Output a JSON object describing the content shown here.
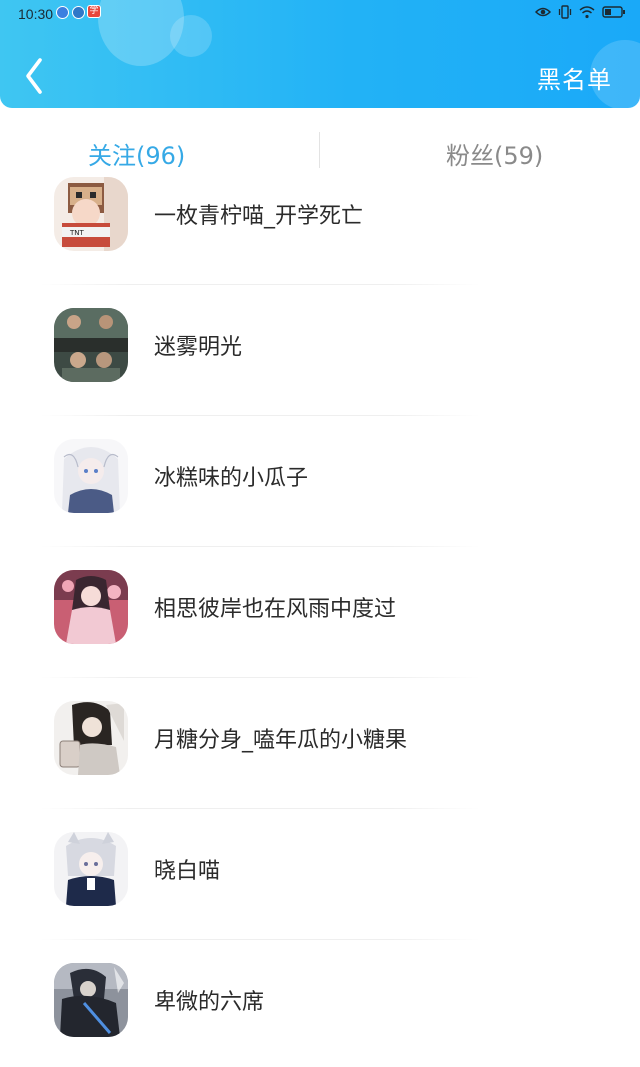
{
  "status_bar": {
    "time": "10:30",
    "badge": "学"
  },
  "header": {
    "back_icon": "chevron-left-icon",
    "blacklist_label": "黑名单"
  },
  "tabs": {
    "following_label": "关注(96)",
    "fans_label": "粉丝(59)"
  },
  "following": [
    {
      "name": "一枚青柠喵_开学死亡"
    },
    {
      "name": "迷雾明光"
    },
    {
      "name": "冰糕味的小瓜子"
    },
    {
      "name": "相思彼岸也在风雨中度过"
    },
    {
      "name": "月糖分身_嗑年瓜的小糖果"
    },
    {
      "name": "晓白喵"
    },
    {
      "name": "卑微的六席"
    }
  ],
  "colors": {
    "header_gradient_start": "#3fc6f2",
    "header_gradient_end": "#1aa9f8",
    "active_tab": "#36a9e6",
    "inactive_tab": "#8a8a8a"
  }
}
